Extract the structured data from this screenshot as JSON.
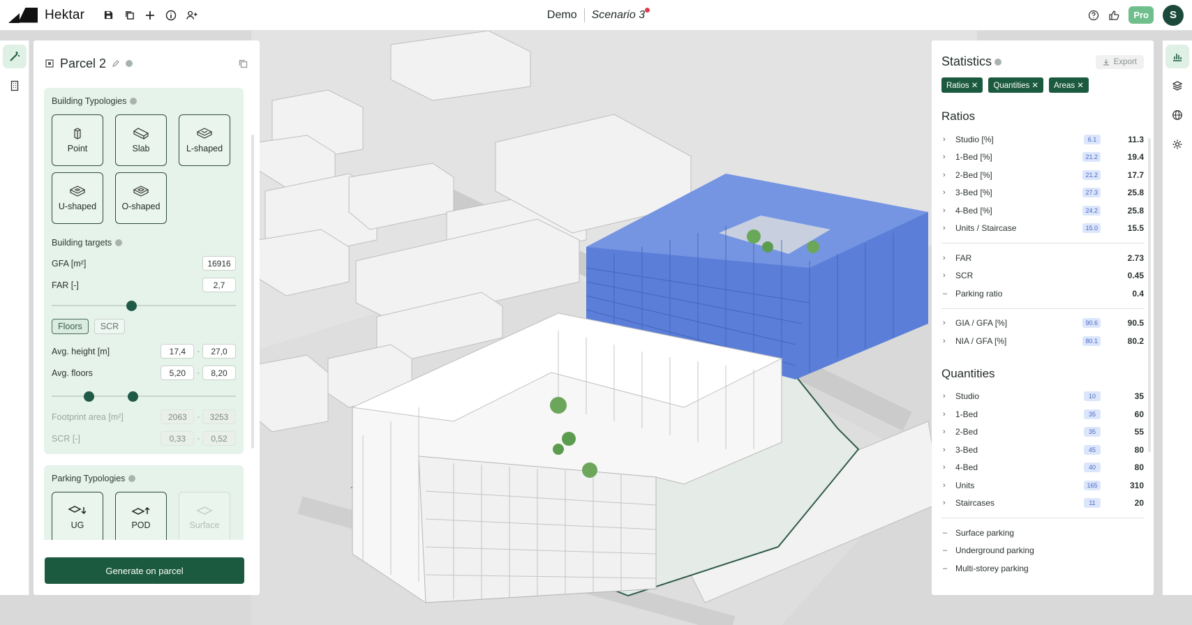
{
  "topbar": {
    "brand": "Hektar",
    "project": "Demo",
    "scenario": "Scenario 3",
    "pro": "Pro",
    "user": "S"
  },
  "left_panel": {
    "title": "Parcel 2",
    "typologies": {
      "title": "Building Typologies",
      "items": [
        "Point",
        "Slab",
        "L-shaped",
        "U-shaped",
        "O-shaped"
      ]
    },
    "targets": {
      "title": "Building targets",
      "gfa_label": "GFA [m²]",
      "gfa_value": "16916",
      "far_label": "FAR [-]",
      "far_value": "2,7",
      "far_slider": 0.43,
      "toggle_floors": "Floors",
      "toggle_scr": "SCR",
      "avg_height_label": "Avg. height [m]",
      "avg_height_min": "17,4",
      "avg_height_max": "27,0",
      "avg_floors_label": "Avg. floors",
      "avg_floors_min": "5,20",
      "avg_floors_max": "8,20",
      "floors_range": [
        0.2,
        0.44
      ],
      "footprint_label": "Footprint area [m²]",
      "footprint_min": "2063",
      "footprint_max": "3253",
      "scr_label": "SCR [-]",
      "scr_min": "0,33",
      "scr_max": "0,52"
    },
    "parking": {
      "title": "Parking Typologies",
      "items": [
        "UG",
        "POD",
        "Surface"
      ]
    },
    "generate": "Generate on parcel"
  },
  "statistics": {
    "title": "Statistics",
    "export": "Export",
    "chips": [
      "Ratios ✕",
      "Quantities ✕",
      "Areas ✕"
    ],
    "ratios_title": "Ratios",
    "ratios": [
      {
        "label": "Studio [%]",
        "pill": "6.1",
        "value": "11.3"
      },
      {
        "label": "1-Bed [%]",
        "pill": "21.2",
        "value": "19.4"
      },
      {
        "label": "2-Bed [%]",
        "pill": "21.2",
        "value": "17.7"
      },
      {
        "label": "3-Bed [%]",
        "pill": "27.3",
        "value": "25.8"
      },
      {
        "label": "4-Bed [%]",
        "pill": "24.2",
        "value": "25.8"
      },
      {
        "label": "Units / Staircase",
        "pill": "15.0",
        "value": "15.5"
      }
    ],
    "far": {
      "label": "FAR",
      "value": "2.73"
    },
    "scr": {
      "label": "SCR",
      "value": "0.45"
    },
    "parking_ratio": {
      "label": "Parking ratio",
      "value": "0.4"
    },
    "gia": {
      "label": "GIA / GFA [%]",
      "pill": "90.6",
      "value": "90.5"
    },
    "nia": {
      "label": "NIA / GFA [%]",
      "pill": "80.1",
      "value": "80.2"
    },
    "quantities_title": "Quantities",
    "quantities": [
      {
        "label": "Studio",
        "pill": "10",
        "value": "35"
      },
      {
        "label": "1-Bed",
        "pill": "35",
        "value": "60"
      },
      {
        "label": "2-Bed",
        "pill": "35",
        "value": "55"
      },
      {
        "label": "3-Bed",
        "pill": "45",
        "value": "80"
      },
      {
        "label": "4-Bed",
        "pill": "40",
        "value": "80"
      },
      {
        "label": "Units",
        "pill": "165",
        "value": "310"
      },
      {
        "label": "Staircases",
        "pill": "11",
        "value": "20"
      }
    ],
    "parking_rows": [
      "Surface parking",
      "Underground parking",
      "Multi-storey parking"
    ]
  },
  "colors": {
    "accent": "#1c5a3f",
    "card": "#e6f3ea",
    "blue_building": "#5b7fd8"
  }
}
